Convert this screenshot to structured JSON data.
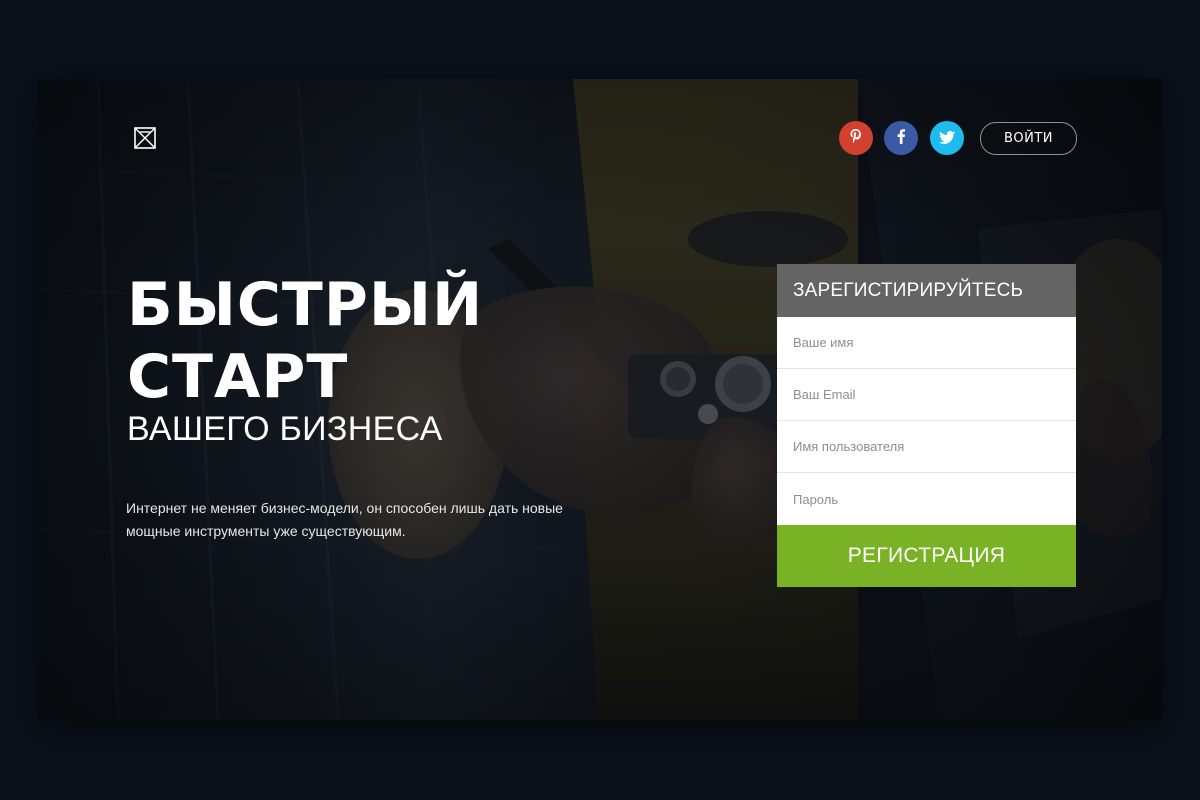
{
  "header": {
    "logo_icon": "crossed-box-logo-icon",
    "social": [
      {
        "name": "pinterest",
        "icon": "pinterest-icon",
        "color": "#d2402f"
      },
      {
        "name": "facebook",
        "icon": "facebook-icon",
        "color": "#3b5aa6"
      },
      {
        "name": "twitter",
        "icon": "twitter-icon",
        "color": "#1ebbee"
      }
    ],
    "login_label": "ВОЙТИ"
  },
  "hero": {
    "title_line1": "БЫСТРЫЙ",
    "title_line2": "СТАРТ",
    "subtitle": "ВАШЕГО БИЗНЕСА",
    "description": "Интернет не меняет бизнес-модели, он способен лишь дать новые мощные инструменты уже существующим."
  },
  "signup": {
    "title": "ЗАРЕГИСТИРИРУЙТЕСЬ",
    "fields": {
      "name_placeholder": "Ваше имя",
      "email_placeholder": "Ваш Email",
      "username_placeholder": "Имя пользователя",
      "password_placeholder": "Пароль"
    },
    "submit_label": "РЕГИСТРАЦИЯ"
  },
  "colors": {
    "page_bg": "#0a111b",
    "form_title_bg": "#646464",
    "submit_bg": "#79b224"
  }
}
